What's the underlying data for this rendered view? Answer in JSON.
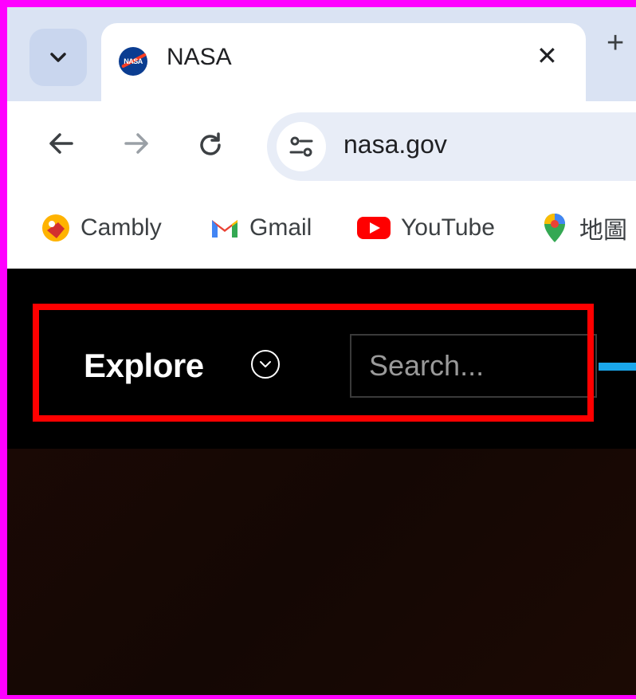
{
  "browser": {
    "tab": {
      "favicon_text": "NASA",
      "title": "NASA",
      "close_glyph": "✕"
    },
    "new_tab_glyph": "+",
    "tab_menu_icon": "chevron-down-icon",
    "nav": {
      "back": "←",
      "forward": "→",
      "reload": "↻"
    },
    "omnibox": {
      "url": "nasa.gov",
      "site_info_icon": "tune-icon"
    },
    "bookmarks": [
      {
        "label": "Cambly",
        "icon": "cambly-icon"
      },
      {
        "label": "Gmail",
        "icon": "gmail-icon"
      },
      {
        "label": "YouTube",
        "icon": "youtube-icon"
      },
      {
        "label": "地圖",
        "icon": "maps-icon"
      }
    ]
  },
  "page": {
    "explore_label": "Explore",
    "search_placeholder": "Search...",
    "colors": {
      "accent": "#1aa7ec",
      "highlight": "#ff0000",
      "frame": "#ff00ff"
    }
  }
}
